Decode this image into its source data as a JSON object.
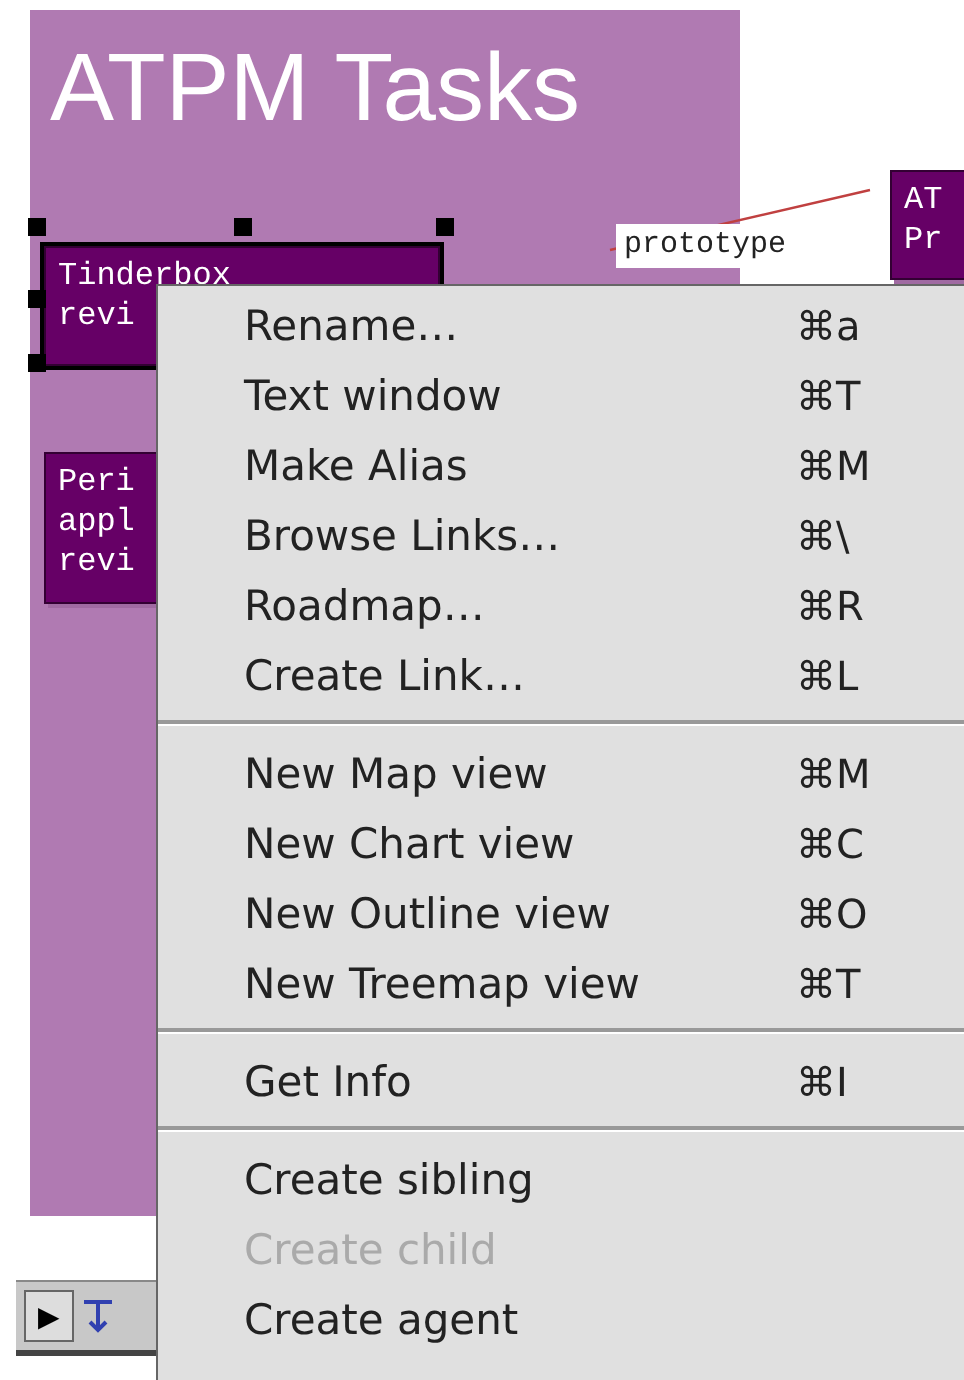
{
  "map": {
    "title": "ATPM Tasks",
    "link_label": "prototype",
    "notes": [
      {
        "lines": [
          "Tinderbox",
          "revi"
        ],
        "selected": true
      },
      {
        "lines": [
          "Peri",
          "appl",
          "revi"
        ],
        "selected": false
      },
      {
        "lines": [
          "AT",
          "Pr"
        ],
        "selected": false
      }
    ],
    "toolbar": {
      "arrow": "▶"
    }
  },
  "context_menu": {
    "groups": [
      [
        {
          "label": "Rename…",
          "shortcut": "⌘a",
          "disabled": false
        },
        {
          "label": "Text window",
          "shortcut": "⌘T",
          "disabled": false
        },
        {
          "label": "Make Alias",
          "shortcut": "⌘M",
          "disabled": false
        },
        {
          "label": "Browse Links…",
          "shortcut": "⌘\\",
          "disabled": false
        },
        {
          "label": "Roadmap…",
          "shortcut": "⌘R",
          "disabled": false
        },
        {
          "label": "Create Link…",
          "shortcut": "⌘L",
          "disabled": false
        }
      ],
      [
        {
          "label": "New Map view",
          "shortcut": "⌘M",
          "disabled": false
        },
        {
          "label": "New Chart view",
          "shortcut": "⌘C",
          "disabled": false
        },
        {
          "label": "New Outline view",
          "shortcut": "⌘O",
          "disabled": false
        },
        {
          "label": "New Treemap view",
          "shortcut": "⌘T",
          "disabled": false
        }
      ],
      [
        {
          "label": "Get Info",
          "shortcut": "⌘I",
          "disabled": false
        }
      ],
      [
        {
          "label": "Create sibling",
          "disabled": false
        },
        {
          "label": "Create child",
          "disabled": true
        },
        {
          "label": "Create agent",
          "disabled": false
        }
      ]
    ]
  }
}
